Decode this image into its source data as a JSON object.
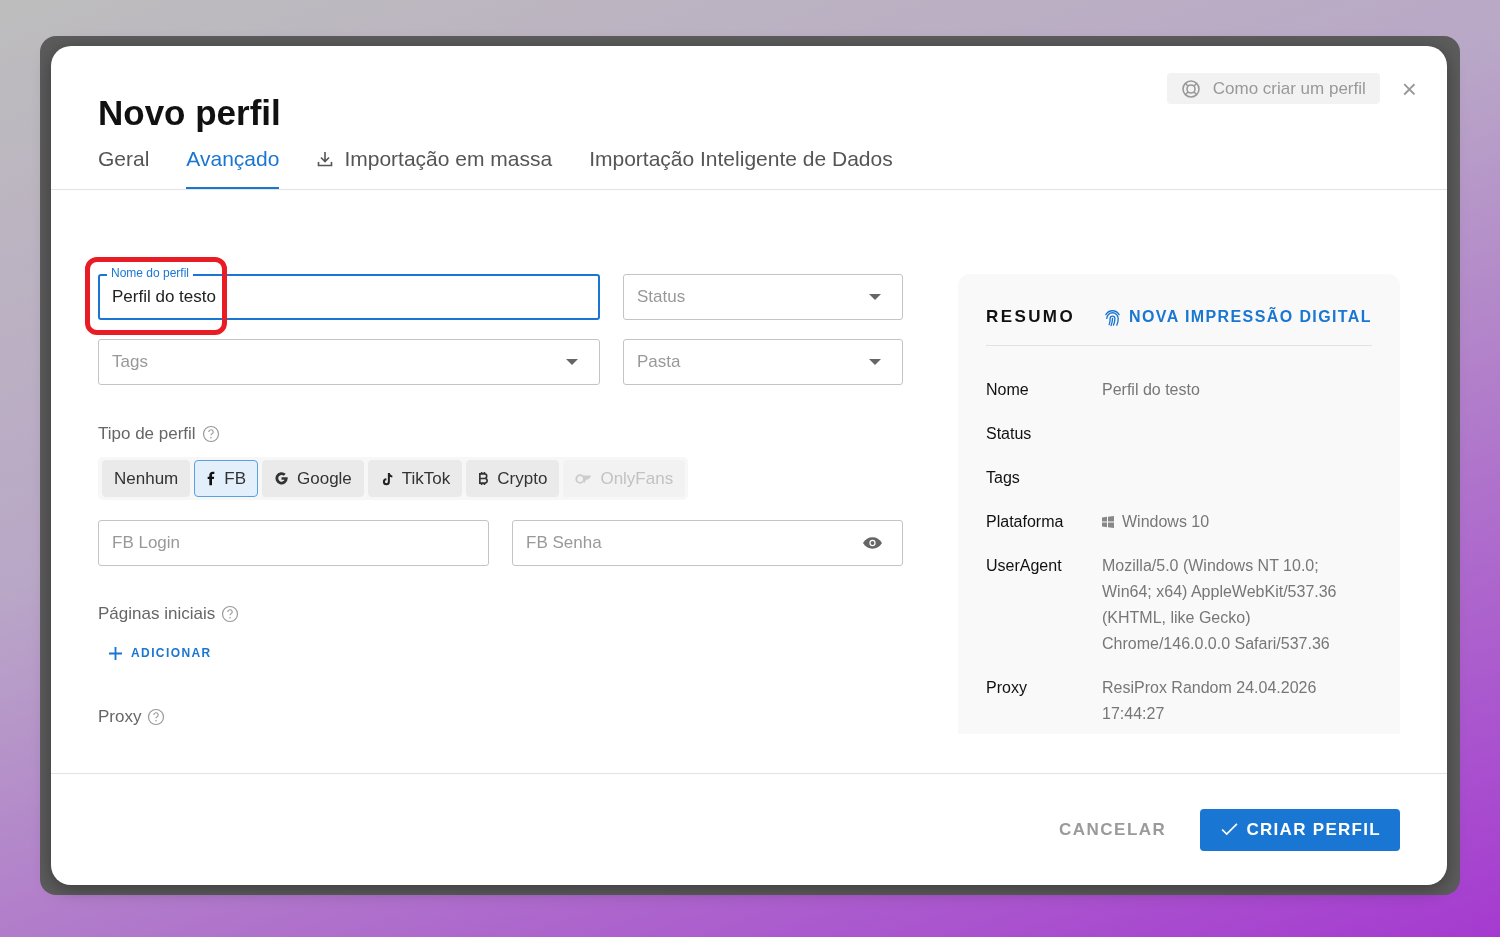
{
  "dialog": {
    "title": "Novo perfil",
    "help_button": "Como criar um perfil",
    "close_label": "×"
  },
  "tabs": [
    {
      "label": "Geral",
      "selected": false,
      "kind": "plain"
    },
    {
      "label": "Avançado",
      "selected": true,
      "kind": "plain"
    },
    {
      "label": "Importação em massa",
      "selected": false,
      "kind": "download"
    },
    {
      "label": "Importação Inteligente de Dados",
      "selected": false,
      "kind": "plain"
    }
  ],
  "fields": {
    "name": {
      "label": "Nome do perfil",
      "value": "Perfil do testo",
      "focused": true
    },
    "status": {
      "placeholder": "Status"
    },
    "tags": {
      "placeholder": "Tags"
    },
    "folder": {
      "placeholder": "Pasta"
    }
  },
  "profile_type": {
    "label": "Tipo de perfil",
    "options": [
      {
        "label": "Nenhum",
        "kind": "none",
        "selected": false,
        "disabled": false
      },
      {
        "label": "FB",
        "kind": "facebook",
        "selected": true,
        "disabled": false
      },
      {
        "label": "Google",
        "kind": "google",
        "selected": false,
        "disabled": false
      },
      {
        "label": "TikTok",
        "kind": "tiktok",
        "selected": false,
        "disabled": false
      },
      {
        "label": "Crypto",
        "kind": "crypto",
        "selected": false,
        "disabled": false
      },
      {
        "label": "OnlyFans",
        "kind": "onlyfans",
        "selected": false,
        "disabled": true
      }
    ]
  },
  "login": {
    "placeholder": "FB Login"
  },
  "password": {
    "placeholder": "FB Senha"
  },
  "start_pages": {
    "label": "Páginas iniciais",
    "add": "ADICIONAR"
  },
  "proxy": {
    "label": "Proxy"
  },
  "summary": {
    "title": "RESUMO",
    "fingerprint_button": "NOVA IMPRESSÃO DIGITAL",
    "rows": [
      {
        "label": "Nome",
        "value": "Perfil do testo"
      },
      {
        "label": "Status"
      },
      {
        "label": "Tags"
      },
      {
        "label": "Plataforma",
        "value": "Windows 10",
        "windows_icon": true
      },
      {
        "label": "UserAgent",
        "value": "Mozilla/5.0 (Windows NT 10.0; Win64; x64) AppleWebKit/537.36 (KHTML, like Gecko) Chrome/146.0.0.0 Safari/537.36"
      },
      {
        "label": "Proxy",
        "value": "ResiProx Random 24.04.2026 17:44:27"
      }
    ]
  },
  "footer": {
    "cancel": "CANCELAR",
    "create": "CRIAR PERFIL"
  }
}
